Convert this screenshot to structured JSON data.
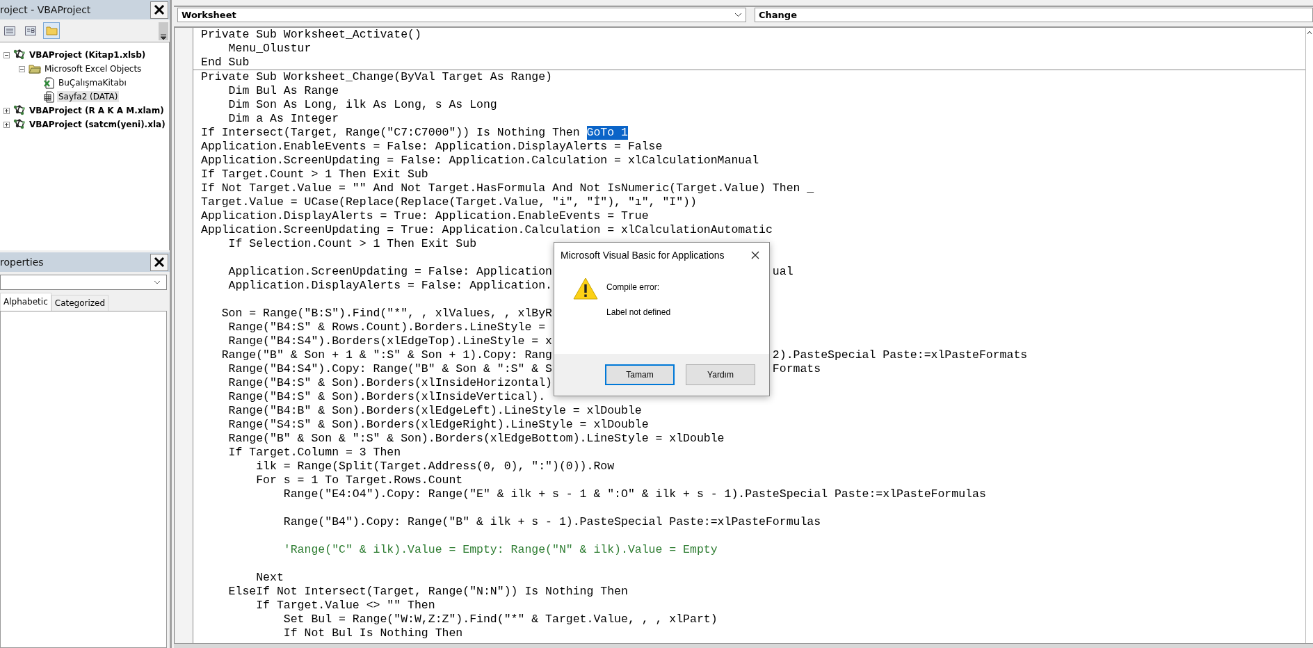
{
  "project_explorer": {
    "title": "roject - VBAProject",
    "toolbar": [
      {
        "kind": "list",
        "selected": false
      },
      {
        "kind": "form",
        "selected": false
      },
      {
        "kind": "folder",
        "selected": true
      }
    ],
    "tree": [
      {
        "label": "VBAProject (Kitap1.xlsb)",
        "kind": "project",
        "expanded": true,
        "selected": false,
        "children": [
          {
            "label": "Microsoft Excel Objects",
            "kind": "folder",
            "expanded": true,
            "selected": false,
            "children": [
              {
                "label": "BuÇalışmaKitabı",
                "kind": "workbook",
                "selected": false
              },
              {
                "label": "Sayfa2 (DATA)",
                "kind": "sheet",
                "selected": true
              }
            ]
          }
        ]
      },
      {
        "label": "VBAProject (R A K A M.xlam)",
        "kind": "project",
        "expanded": false,
        "selected": false
      },
      {
        "label": "VBAProject (satcm(yeni).xla)",
        "kind": "project",
        "expanded": false,
        "selected": false
      }
    ]
  },
  "properties": {
    "title": "roperties",
    "tabs": [
      {
        "label": "Alphabetic",
        "selected": true
      },
      {
        "label": "Categorized",
        "selected": false
      }
    ]
  },
  "editor": {
    "object_dropdown": "Worksheet",
    "procedure_dropdown": "Change",
    "procedures": [
      {
        "lines": [
          {
            "kind": "code",
            "text": "Private Sub Worksheet_Activate()"
          },
          {
            "kind": "code",
            "text": "    Menu_Olustur"
          },
          {
            "kind": "code",
            "text": "End Sub"
          }
        ]
      },
      {
        "lines": [
          {
            "kind": "code",
            "text": "Private Sub Worksheet_Change(ByVal Target As Range)"
          },
          {
            "kind": "code",
            "text": "    Dim Bul As Range"
          },
          {
            "kind": "code",
            "text": "    Dim Son As Long, ilk As Long, s As Long"
          },
          {
            "kind": "code",
            "text": "    Dim a As Integer"
          },
          {
            "kind": "code",
            "text": "If Intersect(Target, Range(\"C7:C7000\")) Is Nothing Then ",
            "selection": "GoTo 1"
          },
          {
            "kind": "code",
            "text": "Application.EnableEvents = False: Application.DisplayAlerts = False"
          },
          {
            "kind": "code",
            "text": "Application.ScreenUpdating = False: Application.Calculation = xlCalculationManual"
          },
          {
            "kind": "code",
            "text": "If Target.Count > 1 Then Exit Sub"
          },
          {
            "kind": "code",
            "text": "If Not Target.Value = \"\" And Not Target.HasFormula And Not IsNumeric(Target.Value) Then _"
          },
          {
            "kind": "code",
            "text": "Target.Value = UCase(Replace(Replace(Target.Value, \"i\", \"İ\"), \"ı\", \"I\"))"
          },
          {
            "kind": "code",
            "text": "Application.DisplayAlerts = True: Application.EnableEvents = True"
          },
          {
            "kind": "code",
            "text": "Application.ScreenUpdating = True: Application.Calculation = xlCalculationAutomatic"
          },
          {
            "kind": "code",
            "text": "    If Selection.Count > 1 Then Exit Sub"
          },
          {
            "kind": "blank"
          },
          {
            "kind": "code",
            "text": "    Application.ScreenUpdating = False: Application",
            "tail": "ual"
          },
          {
            "kind": "code",
            "text": "    Application.DisplayAlerts = False: Application."
          },
          {
            "kind": "blank"
          },
          {
            "kind": "code",
            "text": "   Son = Range(\"B:S\").Find(\"*\", , xlValues, , xlByR"
          },
          {
            "kind": "code",
            "text": "    Range(\"B4:S\" & Rows.Count).Borders.LineStyle ="
          },
          {
            "kind": "code",
            "text": "    Range(\"B4:S4\").Borders(xlEdgeTop).LineStyle = x"
          },
          {
            "kind": "code",
            "text": "   Range(\"B\" & Son + 1 & \":S\" & Son + 1).Copy: Rang",
            "tail": "2).PasteSpecial Paste:=xlPasteFormats"
          },
          {
            "kind": "code",
            "text": "    Range(\"B4:S4\").Copy: Range(\"B\" & Son & \":S\" & S",
            "tail": "Formats"
          },
          {
            "kind": "code",
            "text": "    Range(\"B4:S\" & Son).Borders(xlInsideHorizontal)"
          },
          {
            "kind": "code",
            "text": "    Range(\"B4:S\" & Son).Borders(xlInsideVertical)."
          },
          {
            "kind": "code",
            "text": "    Range(\"B4:B\" & Son).Borders(xlEdgeLeft).LineStyle = xlDouble"
          },
          {
            "kind": "code",
            "text": "    Range(\"S4:S\" & Son).Borders(xlEdgeRight).LineStyle = xlDouble"
          },
          {
            "kind": "code",
            "text": "    Range(\"B\" & Son & \":S\" & Son).Borders(xlEdgeBottom).LineStyle = xlDouble"
          },
          {
            "kind": "code",
            "text": "    If Target.Column = 3 Then"
          },
          {
            "kind": "code",
            "text": "        ilk = Range(Split(Target.Address(0, 0), \":\")(0)).Row"
          },
          {
            "kind": "code",
            "text": "        For s = 1 To Target.Rows.Count"
          },
          {
            "kind": "code",
            "text": "            Range(\"E4:O4\").Copy: Range(\"E\" & ilk + s - 1 & \":O\" & ilk + s - 1).PasteSpecial Paste:=xlPasteFormulas"
          },
          {
            "kind": "blank"
          },
          {
            "kind": "code",
            "text": "            Range(\"B4\").Copy: Range(\"B\" & ilk + s - 1).PasteSpecial Paste:=xlPasteFormulas"
          },
          {
            "kind": "blank"
          },
          {
            "kind": "comment",
            "text": "            'Range(\"C\" & ilk).Value = Empty: Range(\"N\" & ilk).Value = Empty"
          },
          {
            "kind": "blank"
          },
          {
            "kind": "code",
            "text": "        Next"
          },
          {
            "kind": "code",
            "text": "    ElseIf Not Intersect(Target, Range(\"N:N\")) Is Nothing Then"
          },
          {
            "kind": "code",
            "text": "        If Target.Value <> \"\" Then"
          },
          {
            "kind": "code",
            "text": "            Set Bul = Range(\"W:W,Z:Z\").Find(\"*\" & Target.Value, , , xlPart)"
          },
          {
            "kind": "code",
            "text": "            If Not Bul Is Nothing Then"
          }
        ]
      }
    ]
  },
  "dialog": {
    "title": "Microsoft Visual Basic for Applications",
    "heading": "Compile error:",
    "message": "Label not defined",
    "buttons": [
      {
        "label": "Tamam",
        "default": true
      },
      {
        "label": "Yardım",
        "default": false
      }
    ]
  }
}
